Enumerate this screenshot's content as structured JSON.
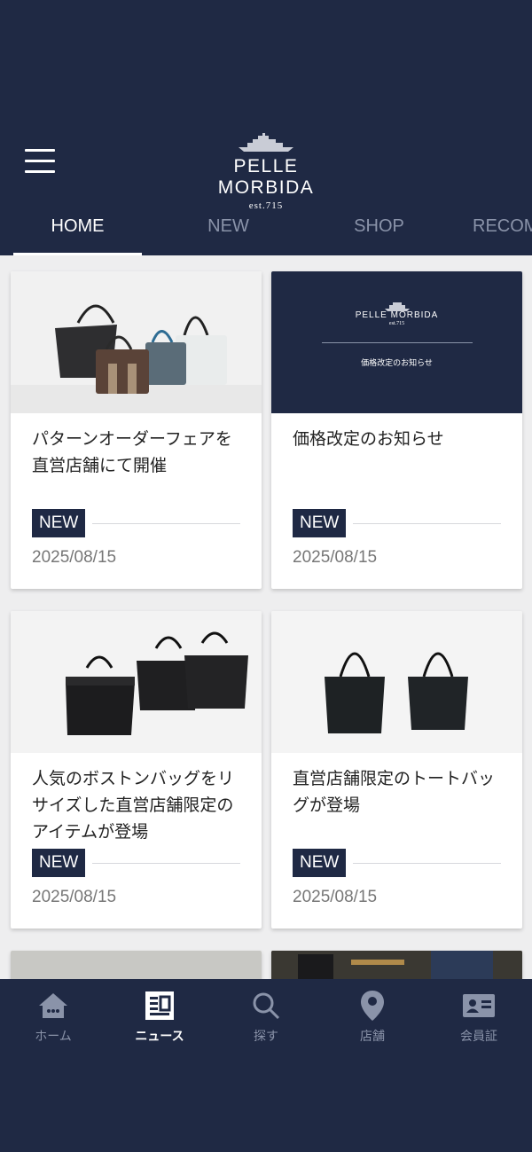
{
  "brand": {
    "name": "PELLE MORBIDA",
    "est": "est.715"
  },
  "tabs": [
    {
      "label": "HOME",
      "active": true
    },
    {
      "label": "NEW",
      "active": false
    },
    {
      "label": "SHOP",
      "active": false
    },
    {
      "label": "RECOM",
      "active": false
    }
  ],
  "cards": [
    {
      "title": "パターンオーダーフェアを直営店舗にて開催",
      "badge": "NEW",
      "date": "2025/08/15"
    },
    {
      "title": "価格改定のお知らせ",
      "badge": "NEW",
      "date": "2025/08/15",
      "banner": {
        "brand": "PELLE MORBIDA",
        "est": "est.715",
        "caption": "価格改定のお知らせ"
      }
    },
    {
      "title": "人気のボストンバッグをリサイズした直営店舗限定のアイテムが登場",
      "badge": "NEW",
      "date": "2025/08/15"
    },
    {
      "title": "直営店舗限定のトートバッグが登場",
      "badge": "NEW",
      "date": "2025/08/15"
    }
  ],
  "nav": [
    {
      "label": "ホーム",
      "icon": "home-icon",
      "active": false
    },
    {
      "label": "ニュース",
      "icon": "news-icon",
      "active": true
    },
    {
      "label": "探す",
      "icon": "search-icon",
      "active": false
    },
    {
      "label": "店舗",
      "icon": "location-pin-icon",
      "active": false
    },
    {
      "label": "会員証",
      "icon": "member-card-icon",
      "active": false
    }
  ],
  "colors": {
    "navy": "#1f2944",
    "background": "#eeeeef",
    "inactive": "#8a93a9"
  }
}
